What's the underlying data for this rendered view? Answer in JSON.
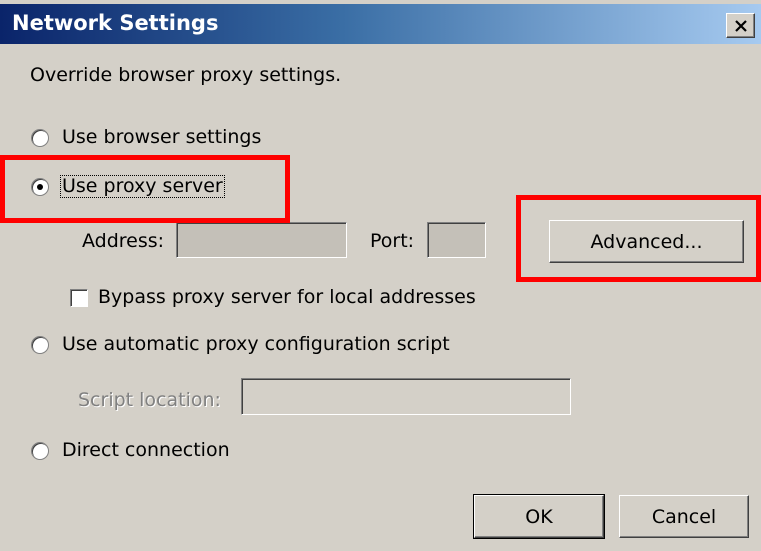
{
  "window": {
    "title": "Network Settings",
    "close_icon": "close-icon"
  },
  "dialog": {
    "description": "Override browser proxy settings.",
    "options": {
      "browser_settings": {
        "label": "Use browser settings",
        "selected": false
      },
      "proxy_server": {
        "label": "Use proxy server",
        "selected": true
      },
      "auto_config": {
        "label": "Use automatic proxy configuration script",
        "selected": false
      },
      "direct": {
        "label": "Direct connection",
        "selected": false
      }
    },
    "proxy": {
      "address_label": "Address:",
      "address_value": "",
      "port_label": "Port:",
      "port_value": "",
      "advanced_label": "Advanced...",
      "bypass_label": "Bypass proxy server for local addresses",
      "bypass_checked": false
    },
    "script": {
      "location_label": "Script location:",
      "location_value": ""
    },
    "buttons": {
      "ok": "OK",
      "cancel": "Cancel"
    }
  },
  "colors": {
    "dialog_bg": "#d4d0c8",
    "title_start": "#0a246a",
    "title_end": "#a6caf0",
    "highlight": "#ff0000"
  }
}
